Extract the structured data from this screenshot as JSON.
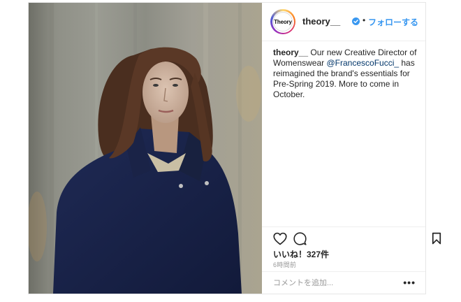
{
  "post": {
    "account": {
      "username": "theory__",
      "avatar_text": "Theory",
      "verified": true,
      "separator": "•",
      "follow_label": "フォローする"
    },
    "caption": {
      "username": "theory__",
      "text_before": " Our new Creative Director of Womenswear ",
      "mention": "@FrancescoFucci_",
      "text_after": " has reimagined the brand's essentials for Pre-Spring 2019. More to come in October."
    },
    "likes_text": "いいね！327件",
    "time_text": "6時間前",
    "comment_placeholder": "コメントを追加...",
    "more_label": "•••",
    "icons": {
      "like": "heart-icon",
      "comment": "comment-icon",
      "save": "bookmark-icon",
      "verified": "verified-badge-icon"
    }
  },
  "colors": {
    "accent": "#3897f0",
    "mention": "#003569",
    "text": "#262626",
    "muted": "#999999",
    "border": "#efefef"
  }
}
